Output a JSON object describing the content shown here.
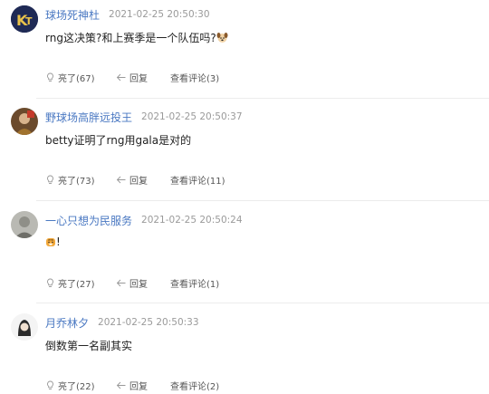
{
  "comments": [
    {
      "username": "球场死神杜",
      "time": "2021-02-25 20:50:30",
      "text": "rng这决策?和上赛季是一个队伍吗?",
      "emoji_icon": "dog-face-icon",
      "likes_label": "亮了(67)",
      "reply_label": "回复",
      "view_label": "查看评论(3)"
    },
    {
      "username": "野球场高胖远投王",
      "time": "2021-02-25 20:50:37",
      "text": "betty证明了rng用gala是对的",
      "likes_label": "亮了(73)",
      "reply_label": "回复",
      "view_label": "查看评论(11)"
    },
    {
      "username": "一心只想为民服务",
      "time": "2021-02-25 20:50:24",
      "text": "!",
      "emoji_icon": "tiger-face-icon",
      "likes_label": "亮了(27)",
      "reply_label": "回复",
      "view_label": "查看评论(1)"
    },
    {
      "username": "月乔林夕",
      "time": "2021-02-25 20:50:33",
      "text": "倒数第一名副其实",
      "likes_label": "亮了(22)",
      "reply_label": "回复",
      "view_label": "查看评论(2)"
    }
  ],
  "icons": {
    "like": "lightbulb-icon",
    "reply": "reply-arrow-icon"
  },
  "colors": {
    "username": "#4a78c2",
    "timestamp": "#9a9a9a",
    "action_text": "#555555",
    "divider": "#ececec"
  }
}
